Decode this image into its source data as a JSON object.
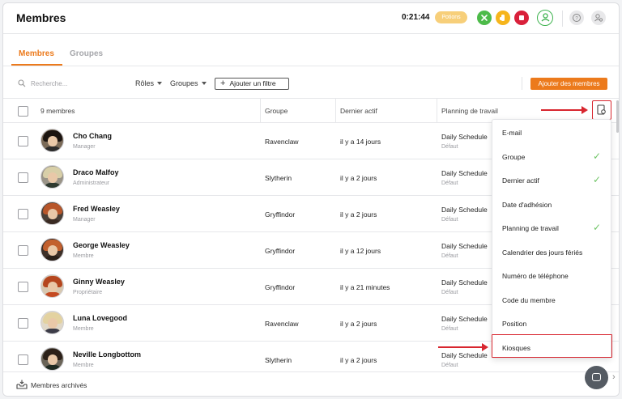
{
  "header": {
    "title": "Membres",
    "timer": "0:21:44",
    "task_badge": "Potions",
    "icons": [
      "play-icon",
      "hand-icon",
      "stop-icon",
      "user-circle-icon",
      "help-icon",
      "user-settings-icon"
    ]
  },
  "tabs": [
    {
      "label": "Membres",
      "active": true
    },
    {
      "label": "Groupes",
      "active": false
    }
  ],
  "filters": {
    "search_placeholder": "Recherche...",
    "roles_label": "Rôles",
    "groups_label": "Groupes",
    "add_filter_label": "Ajouter un filtre",
    "add_members_label": "Ajouter des membres"
  },
  "table": {
    "count_label": "9 membres",
    "columns": [
      "Groupe",
      "Dernier actif",
      "Planning de travail"
    ],
    "rows": [
      {
        "name": "Cho Chang",
        "role": "Manager",
        "group": "Ravenclaw",
        "last_active": "il y a 14 jours",
        "schedule": "Daily Schedule",
        "schedule_sub": "Défaut"
      },
      {
        "name": "Draco Malfoy",
        "role": "Administrateur",
        "group": "Slytherin",
        "last_active": "il y a 2 jours",
        "schedule": "Daily Schedule",
        "schedule_sub": "Défaut"
      },
      {
        "name": "Fred Weasley",
        "role": "Manager",
        "group": "Gryffindor",
        "last_active": "il y a 2 jours",
        "schedule": "Daily Schedule",
        "schedule_sub": "Défaut"
      },
      {
        "name": "George Weasley",
        "role": "Membre",
        "group": "Gryffindor",
        "last_active": "il y a 12 jours",
        "schedule": "Daily Schedule",
        "schedule_sub": "Défaut"
      },
      {
        "name": "Ginny Weasley",
        "role": "Propriétaire",
        "group": "Gryffindor",
        "last_active": "il y a 21 minutes",
        "schedule": "Daily Schedule",
        "schedule_sub": "Défaut"
      },
      {
        "name": "Luna Lovegood",
        "role": "Membre",
        "group": "Ravenclaw",
        "last_active": "il y a 2 jours",
        "schedule": "Daily Schedule",
        "schedule_sub": "Défaut"
      },
      {
        "name": "Neville Longbottom",
        "role": "Membre",
        "group": "Slytherin",
        "last_active": "il y a 2 jours",
        "schedule": "Daily Schedule",
        "schedule_sub": "Défaut"
      }
    ]
  },
  "column_menu": {
    "options": [
      {
        "label": "E-mail",
        "checked": false
      },
      {
        "label": "Groupe",
        "checked": true
      },
      {
        "label": "Dernier actif",
        "checked": true
      },
      {
        "label": "Date d'adhésion",
        "checked": false
      },
      {
        "label": "Planning de travail",
        "checked": true
      },
      {
        "label": "Calendrier des jours fériés",
        "checked": false
      },
      {
        "label": "Numéro de téléphone",
        "checked": false
      },
      {
        "label": "Code du membre",
        "checked": false
      },
      {
        "label": "Position",
        "checked": false
      },
      {
        "label": "Kiosques",
        "checked": false
      }
    ],
    "highlighted": "Kiosques"
  },
  "footer": {
    "archived_label": "Membres archivés"
  },
  "colors": {
    "accent": "#ec7a1c",
    "annotation": "#d8262f",
    "check": "#6fc466"
  }
}
